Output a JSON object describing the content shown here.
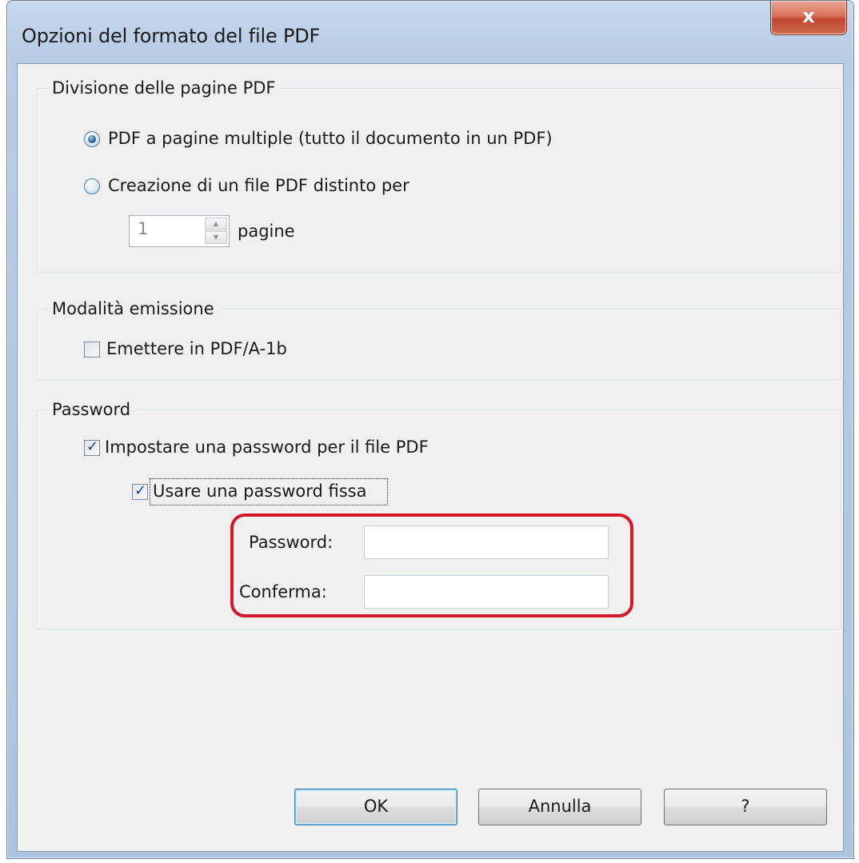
{
  "window": {
    "title": "Opzioni del formato del file PDF",
    "close_label": "x"
  },
  "division": {
    "group_label": "Divisione delle pagine PDF",
    "option_multi_label": "PDF a pagine multiple (tutto il documento in un PDF)",
    "option_multi_selected": true,
    "option_split_label": "Creazione di un file PDF distinto per",
    "option_split_selected": false,
    "pages_value": "1",
    "pages_suffix": "pagine"
  },
  "output_mode": {
    "group_label": "Modalità emissione",
    "pdfa_label": "Emettere in PDF/A-1b",
    "pdfa_checked": false
  },
  "password": {
    "group_label": "Password",
    "set_password_label": "Impostare una password per il file PDF",
    "set_password_checked": true,
    "fixed_password_label": "Usare una password fissa",
    "fixed_password_checked": true,
    "password_field_label": "Password:",
    "password_value": "",
    "confirm_field_label": "Conferma:",
    "confirm_value": "",
    "check_glyph": "✓"
  },
  "buttons": {
    "ok": "OK",
    "cancel": "Annulla",
    "help": "?"
  },
  "colors": {
    "highlight": "#d3182a",
    "radio_selected": "#2b5f94",
    "close_button": "#c0472f"
  }
}
